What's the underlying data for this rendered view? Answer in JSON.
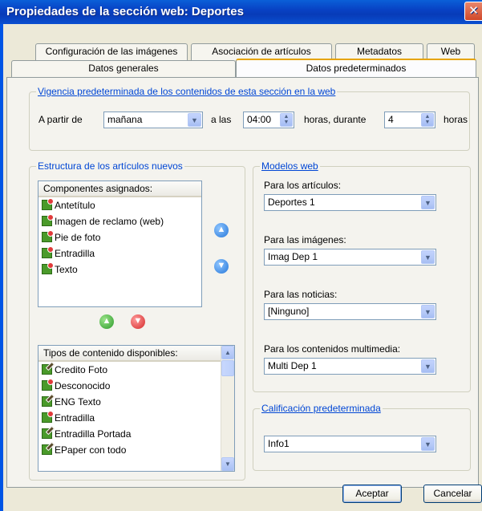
{
  "window": {
    "title": "Propiedades de la sección web: Deportes",
    "close": "✕"
  },
  "tabs_row1": [
    "Configuración de las imágenes",
    "Asociación de artículos",
    "Metadatos",
    "Web"
  ],
  "tabs_row2": [
    "Datos generales",
    "Datos predeterminados"
  ],
  "vigencia": {
    "legend": "Vigencia predeterminada de los contenidos de esta sección en la web",
    "a_partir_label": "A partir de",
    "a_partir_value": "mañana",
    "a_las_label": "a las",
    "time_value": "04:00",
    "horas_durante_label": "horas, durante",
    "duration_value": "4",
    "horas_label": "horas"
  },
  "estructura": {
    "legend": "Estructura de los artículos nuevos",
    "assigned_header": "Componentes asignados:",
    "assigned_items": [
      "Antetítulo",
      "Imagen de reclamo (web)",
      "Pie de foto",
      "Entradilla",
      "Texto"
    ],
    "available_header": "Tipos de contenido disponibles:",
    "available_items": [
      "Credito Foto",
      "Desconocido",
      "ENG Texto",
      "Entradilla",
      "Entradilla Portada",
      "EPaper con todo"
    ]
  },
  "modelos": {
    "legend": "Modelos web",
    "articulos_label": "Para los artículos:",
    "articulos_value": "Deportes 1",
    "imagenes_label": "Para las imágenes:",
    "imagenes_value": "Imag Dep 1",
    "noticias_label": "Para las noticias:",
    "noticias_value": "[Ninguno]",
    "multimedia_label": "Para los contenidos multimedia:",
    "multimedia_value": "Multi Dep 1"
  },
  "calificacion": {
    "legend": "Calificación predeterminada",
    "value": "Info1"
  },
  "buttons": {
    "accept": "Aceptar",
    "cancel": "Cancelar"
  }
}
